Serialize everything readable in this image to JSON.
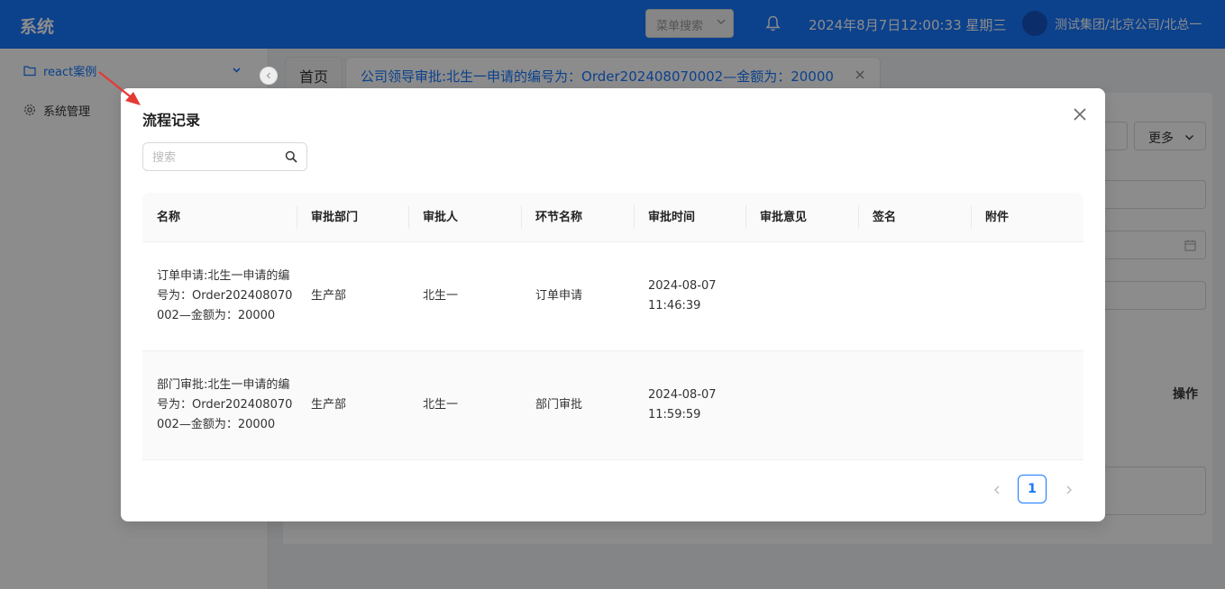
{
  "header": {
    "app_title": "系统",
    "menu_search_label": "菜单搜索",
    "datetime": "2024年8月7日12:00:33 星期三",
    "org_path": "测试集团/北京公司/北总一"
  },
  "sidebar": {
    "items": [
      {
        "label": "react案例",
        "icon": "folder-icon",
        "active": true
      },
      {
        "label": "系统管理",
        "icon": "gear-icon",
        "active": false
      }
    ]
  },
  "tabs": {
    "home": "首页",
    "active": "公司领导审批:北生一申请的编号为：Order202408070002—金额为：20000"
  },
  "background": {
    "more_label": "更多",
    "ops_label": "操作"
  },
  "modal": {
    "title": "流程记录",
    "search_placeholder": "搜索",
    "columns": [
      "名称",
      "审批部门",
      "审批人",
      "环节名称",
      "审批时间",
      "审批意见",
      "签名",
      "附件"
    ],
    "rows": [
      {
        "name": "订单申请:北生一申请的编号为：Order202408070002—金额为：20000",
        "dept": "生产部",
        "approver": "北生一",
        "step": "订单申请",
        "time_date": "2024-08-07",
        "time_clock": "11:46:39",
        "opinion": "",
        "signature": "",
        "attachment": ""
      },
      {
        "name": "部门审批:北生一申请的编号为：Order202408070002—金额为：20000",
        "dept": "生产部",
        "approver": "北生一",
        "step": "部门审批",
        "time_date": "2024-08-07",
        "time_clock": "11:59:59",
        "opinion": "",
        "signature": "",
        "attachment": ""
      }
    ],
    "pagination": {
      "current_page": "1"
    }
  },
  "colors": {
    "primary": "#1677ff",
    "annotation_arrow": "#e53935"
  }
}
